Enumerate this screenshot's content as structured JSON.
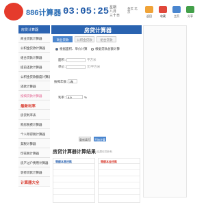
{
  "header": {
    "logo_label": "886",
    "site_name": "886计算器",
    "clock": "03:05:25",
    "date": "星期 八月 三十日",
    "weather": "多云 北京",
    "shortcuts": [
      {
        "label": "返回",
        "color": "#f0a338"
      },
      {
        "label": "收藏",
        "color": "#e0473a"
      },
      {
        "label": "主页",
        "color": "#4a86cf"
      },
      {
        "label": "分享",
        "color": "#43a04a"
      }
    ]
  },
  "sidebar": {
    "title": "房贷计算器",
    "items": [
      {
        "label": "商业贷款计算器",
        "style": ""
      },
      {
        "label": "公积金贷款计算器",
        "style": ""
      },
      {
        "label": "组合贷款计算器",
        "style": ""
      },
      {
        "label": "提前还款计算器",
        "style": ""
      },
      {
        "label": "公积金贷款额度计算器",
        "style": ""
      },
      {
        "label": "还款计算器",
        "style": ""
      },
      {
        "label": "按揭贷款计算器",
        "style": "pink"
      },
      {
        "label": "最新利率",
        "style": "red"
      },
      {
        "label": "房贷利率表",
        "style": ""
      },
      {
        "label": "购房税费计算器",
        "style": ""
      },
      {
        "label": "个人所得税计算器",
        "style": ""
      },
      {
        "label": "契税计算器",
        "style": ""
      },
      {
        "label": "印花税计算器",
        "style": ""
      },
      {
        "label": "房产过户费用计算器",
        "style": ""
      },
      {
        "label": "装修贷款计算器",
        "style": ""
      },
      {
        "label": "计算器大全",
        "style": "red"
      }
    ]
  },
  "main": {
    "title": "房贷计算器",
    "tabs": [
      "商业贷款",
      "公积金贷款",
      "组合贷款"
    ],
    "method_a": "根据面积、单价计算",
    "method_b": "根据贷款总额计算",
    "area_label": "面积：",
    "area_unit": "平方米",
    "price_label": "单价：",
    "price_unit": "元/平方米",
    "years_label": "按揭年数：",
    "years_value": "1年",
    "rate_label": "利率：",
    "rate_value": "4.9",
    "rate_unit": "%",
    "reset_label": "重新填写",
    "calc_label": "开始计算",
    "result_title": "房贷计算器计算结果",
    "result_note": "(结果仅供参考)",
    "col_a": "等额本息还款",
    "col_b": "等额本金还款"
  }
}
